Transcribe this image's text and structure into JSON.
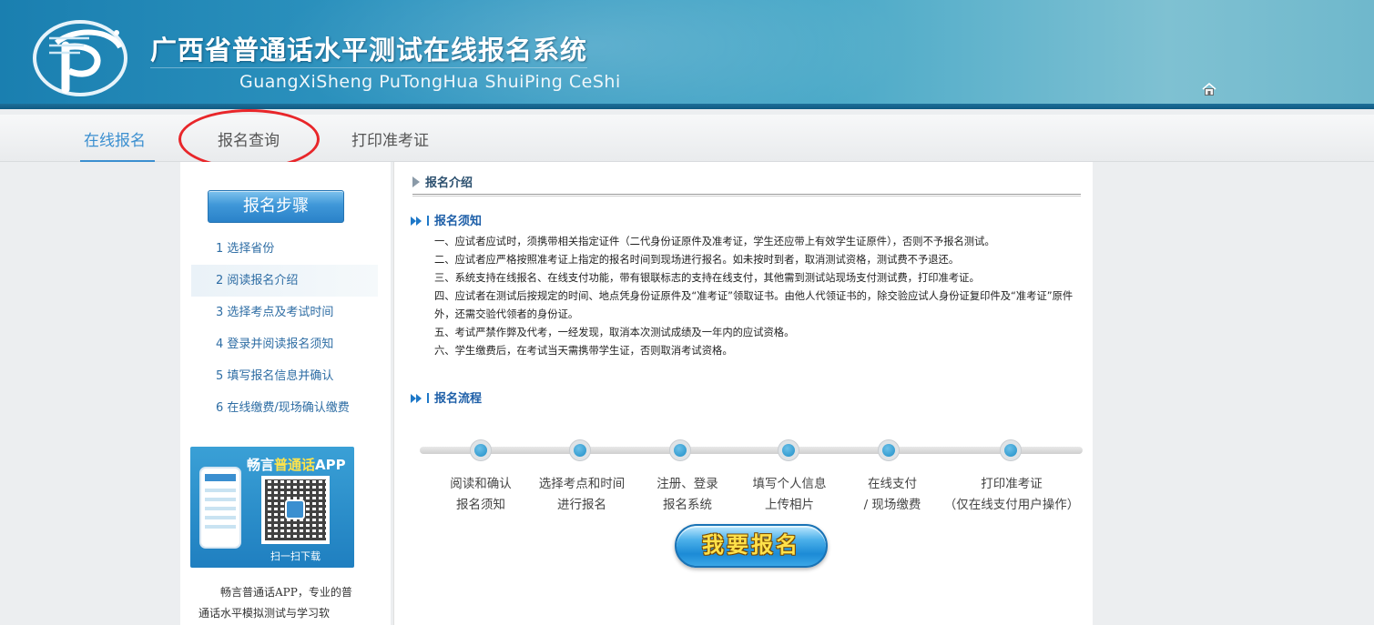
{
  "header": {
    "title_cn": "广西省普通话水平测试在线报名系统",
    "title_en": "GuangXiSheng PuTongHua ShuiPing CeShi",
    "home_icon": "home-icon"
  },
  "nav": {
    "items": [
      {
        "label": "在线报名",
        "active": true
      },
      {
        "label": "报名查询",
        "active": false
      },
      {
        "label": "打印准考证",
        "active": false
      }
    ]
  },
  "sidebar": {
    "steps_title": "报名步骤",
    "steps": [
      "1 选择省份",
      "2 阅读报名介绍",
      "3 选择考点及考试时间",
      "4 登录并阅读报名须知",
      "5 填写报名信息并确认",
      "6 在线缴费/现场确认缴费"
    ],
    "current_step": 1,
    "app_card": {
      "title_prefix": "畅言",
      "title_highlight": "普通话",
      "title_suffix": "APP",
      "scan_text": "扫一扫下载"
    },
    "app_desc": "畅言普通话APP，专业的普通话水平模拟测试与学习软"
  },
  "main": {
    "section_title": "报名介绍",
    "notice_title": "报名须知",
    "rules": [
      "一、应试者应试时，须携带相关指定证件（二代身份证原件及准考证，学生还应带上有效学生证原件），否则不予报名测试。",
      "二、应试者应严格按照准考证上指定的报名时间到现场进行报名。如未按时到者，取消测试资格，测试费不予退还。",
      "三、系统支持在线报名、在线支付功能，带有银联标志的支持在线支付，其他需到测试站现场支付测试费，打印准考证。",
      "四、应试者在测试后按规定的时间、地点凭身份证原件及“准考证”领取证书。由他人代领证书的，除交验应试人身份证复印件及“准考证”原件外，还需交验代领者的身份证。",
      "五、考试严禁作弊及代考，一经发现，取消本次测试成绩及一年内的应试资格。",
      "六、学生缴费后，在考试当天需携带学生证，否则取消考试资格。"
    ],
    "process_title": "报名流程",
    "process_steps": [
      {
        "line1": "阅读和确认",
        "line2": "报名须知"
      },
      {
        "line1": "选择考点和时间",
        "line2": "进行报名"
      },
      {
        "line1": "注册、登录",
        "line2": "报名系统"
      },
      {
        "line1": "填写个人信息",
        "line2": "上传相片"
      },
      {
        "line1": "在线支付",
        "line2": "/ 现场缴费"
      },
      {
        "line1": "打印准考证",
        "line2": "（仅在线支付用户操作）"
      }
    ],
    "signup_button": "我要报名"
  },
  "colors": {
    "accent": "#3b8fd0",
    "highlight_ring": "#e8262a",
    "link": "#2e6da4"
  }
}
